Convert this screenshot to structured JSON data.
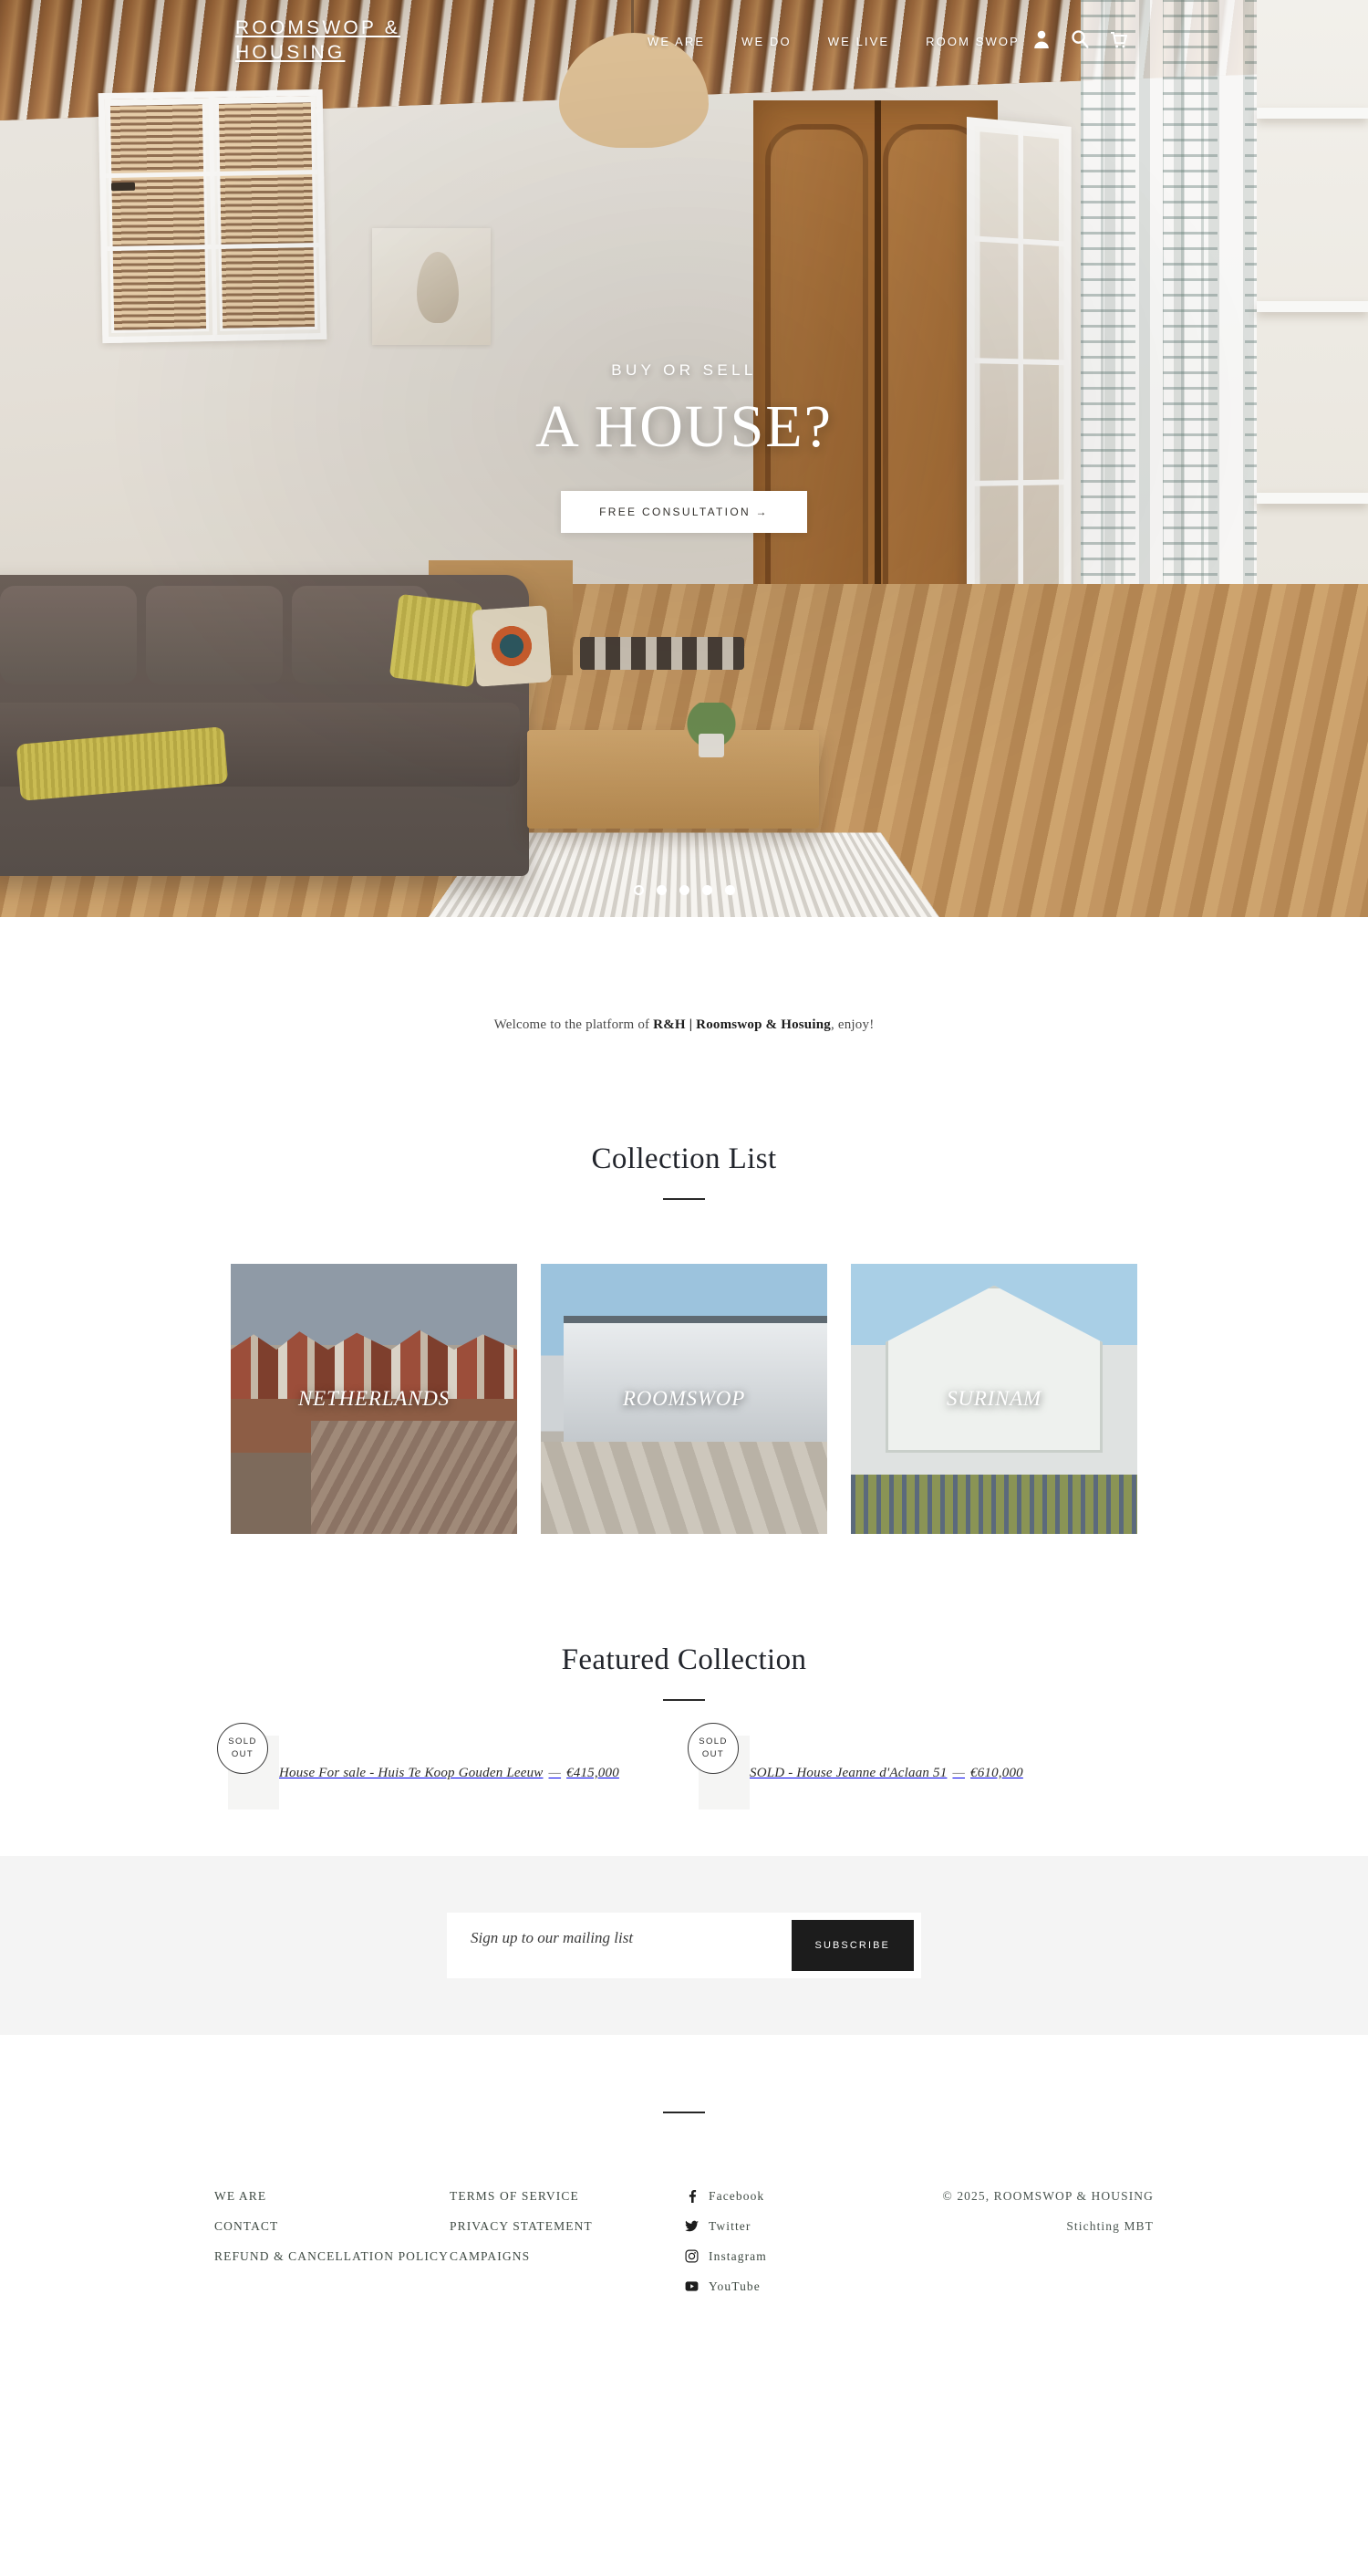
{
  "header": {
    "brand": "ROOMSWOP & HOUSING",
    "nav": [
      {
        "label": "WE ARE"
      },
      {
        "label": "WE DO"
      },
      {
        "label": "WE LIVE"
      },
      {
        "label": "ROOM SWOP"
      }
    ],
    "icons": [
      {
        "name": "account-icon",
        "title": "Account"
      },
      {
        "name": "search-icon",
        "title": "Search"
      },
      {
        "name": "cart-icon",
        "title": "Cart"
      }
    ]
  },
  "hero": {
    "kicker": "BUY OR SELL",
    "title": "A HOUSE?",
    "cta": "FREE CONSULTATION  →",
    "slides": 5,
    "active_slide": 1
  },
  "welcome": {
    "prefix": "Welcome to the platform of ",
    "brand": "R&H | Roomswop & Hosuing",
    "suffix": ", enjoy!"
  },
  "collection_list": {
    "title": "Collection List",
    "items": [
      {
        "label": "NETHERLANDS",
        "photo": "ph-netherlands"
      },
      {
        "label": "ROOMSWOP",
        "photo": "ph-roomswop"
      },
      {
        "label": "SURINAM",
        "photo": "ph-surinam"
      }
    ]
  },
  "featured_collection": {
    "title": "Featured Collection",
    "products": [
      {
        "badge_line1": "SOLD",
        "badge_line2": "OUT",
        "title": "House For sale - Huis Te Koop Gouden Leeuw",
        "dash": "—",
        "price": "€415,000",
        "photo": "ph-flat"
      },
      {
        "badge_line1": "SOLD",
        "badge_line2": "OUT",
        "title": "SOLD - House Jeanne d'Aclaan 51",
        "dash": "—",
        "price": "€610,000",
        "photo": "ph-house"
      }
    ]
  },
  "newsletter": {
    "placeholder": "Sign up to our mailing list",
    "button": "SUBSCRIBE",
    "value": ""
  },
  "footer": {
    "col1": [
      {
        "label": "WE ARE"
      },
      {
        "label": "CONTACT"
      },
      {
        "label": "REFUND & CANCELLATION POLICY"
      }
    ],
    "col2": [
      {
        "label": "TERMS OF SERVICE"
      },
      {
        "label": "PRIVACY STATEMENT"
      },
      {
        "label": "CAMPAIGNS"
      }
    ],
    "social": [
      {
        "label": "Facebook",
        "icon": "facebook-icon"
      },
      {
        "label": "Twitter",
        "icon": "twitter-icon"
      },
      {
        "label": "Instagram",
        "icon": "instagram-icon"
      },
      {
        "label": "YouTube",
        "icon": "youtube-icon"
      }
    ],
    "copyright_line1": "© 2025, ROOMSWOP & HOUSING",
    "copyright_line2": "Stichting MBT"
  },
  "colors": {
    "accent_dark": "#1c1c1c",
    "page_bg": "#ffffff",
    "panel_bg": "#f4f4f4",
    "product_bg": "#f5f5f4",
    "text": "#2e2e2e",
    "footer_link": "#3f4a43"
  }
}
